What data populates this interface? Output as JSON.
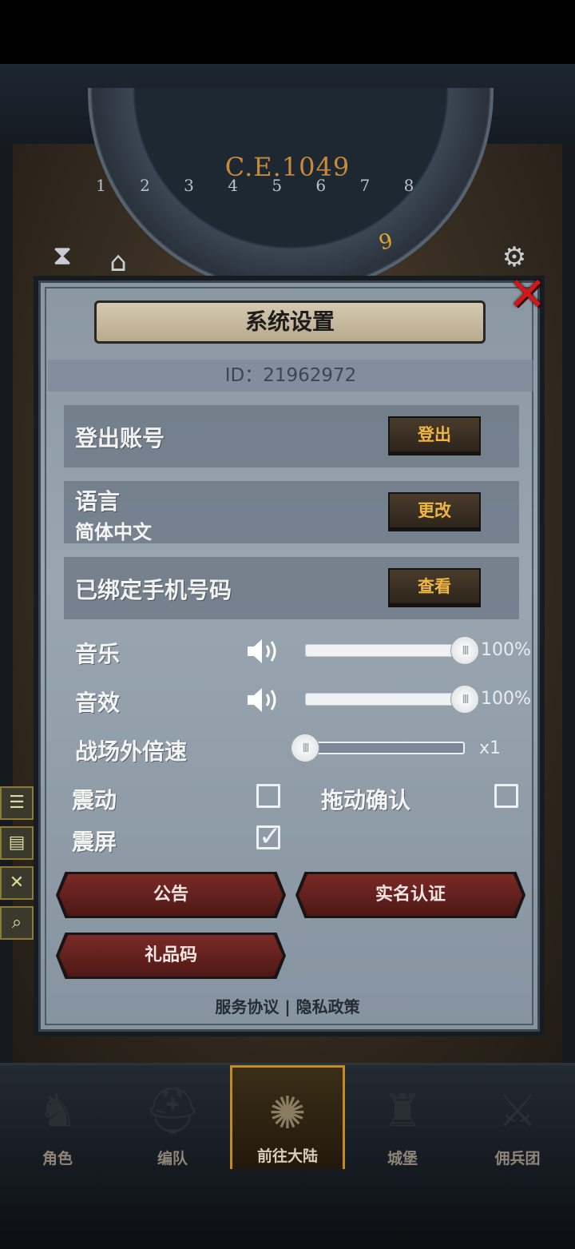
{
  "hud": {
    "year": "C.E.1049",
    "hour": "9",
    "ticks": "1 2 3 4 5 6 7 8"
  },
  "dialog": {
    "title": "系统设置",
    "id_text": "ID：21962972",
    "logout_row": {
      "label": "登出账号",
      "button": "登出"
    },
    "language_row": {
      "label": "语言",
      "value": "简体中文",
      "button": "更改"
    },
    "phone_row": {
      "label": "已绑定手机号码",
      "button": "查看"
    },
    "music": {
      "label": "音乐",
      "percent_text": "100%",
      "level": 1.0
    },
    "sfx": {
      "label": "音效",
      "percent_text": "100%",
      "level": 1.0
    },
    "speed": {
      "label": "战场外倍速",
      "value_text": "x1",
      "level": 0.0
    },
    "vibrate": {
      "label": "震动",
      "checked": false
    },
    "drag_confirm": {
      "label": "拖动确认",
      "checked": false
    },
    "shake_screen": {
      "label": "震屏",
      "checked": true
    },
    "buttons": {
      "announcement": "公告",
      "real_name": "实名认证",
      "gift_code": "礼品码"
    },
    "footer": {
      "terms": "服务协议",
      "separator": "|",
      "privacy": "隐私政策"
    }
  },
  "bottom_nav": [
    {
      "label": "角色",
      "icon": "knight-icon",
      "active": false
    },
    {
      "label": "编队",
      "icon": "helmet-icon",
      "active": false
    },
    {
      "label": "前往大陆",
      "icon": "compass-icon",
      "active": true
    },
    {
      "label": "城堡",
      "icon": "castle-icon",
      "active": false
    },
    {
      "label": "佣兵团",
      "icon": "mercenary-icon",
      "active": false
    }
  ],
  "colors": {
    "accent_gold": "#f0b545",
    "close_red": "#d01818",
    "dialog_bg": "#99a6b1",
    "red_button": "#6a2420"
  }
}
